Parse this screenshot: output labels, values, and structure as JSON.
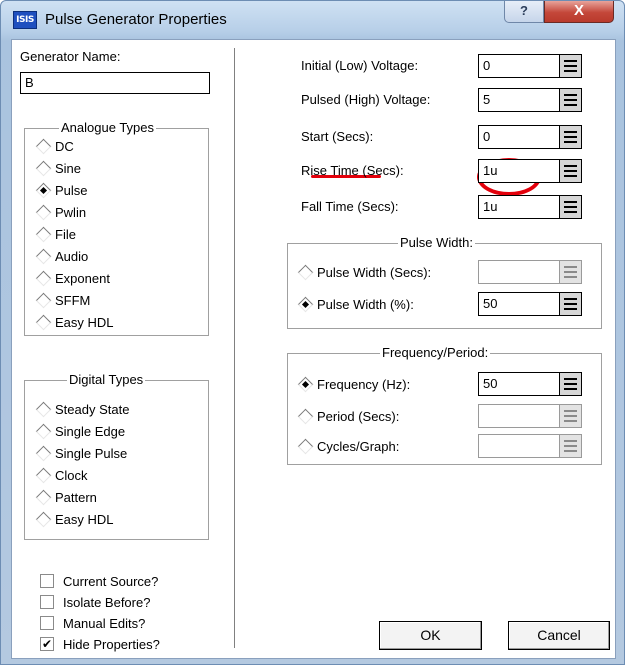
{
  "window": {
    "app_icon_text": "ISIS",
    "title": "Pulse Generator Properties",
    "help_glyph": "?",
    "close_glyph": "X"
  },
  "left": {
    "generator_name_label": "Generator Name:",
    "generator_name_value": "B",
    "analogue_title": "Analogue Types",
    "analogue": [
      {
        "label": "DC",
        "checked": false
      },
      {
        "label": "Sine",
        "checked": false
      },
      {
        "label": "Pulse",
        "checked": true
      },
      {
        "label": "Pwlin",
        "checked": false
      },
      {
        "label": "File",
        "checked": false
      },
      {
        "label": "Audio",
        "checked": false
      },
      {
        "label": "Exponent",
        "checked": false
      },
      {
        "label": "SFFM",
        "checked": false
      },
      {
        "label": "Easy HDL",
        "checked": false
      }
    ],
    "digital_title": "Digital Types",
    "digital": [
      {
        "label": "Steady State",
        "checked": false
      },
      {
        "label": "Single Edge",
        "checked": false
      },
      {
        "label": "Single Pulse",
        "checked": false
      },
      {
        "label": "Clock",
        "checked": false
      },
      {
        "label": "Pattern",
        "checked": false
      },
      {
        "label": "Easy HDL",
        "checked": false
      }
    ],
    "checkboxes": [
      {
        "label": "Current Source?",
        "checked": false
      },
      {
        "label": "Isolate Before?",
        "checked": false
      },
      {
        "label": "Manual Edits?",
        "checked": false
      },
      {
        "label": "Hide Properties?",
        "checked": true
      }
    ],
    "check_mark": "✔"
  },
  "right": {
    "fields": [
      {
        "label": "Initial (Low) Voltage:",
        "value": "0"
      },
      {
        "label": "Pulsed (High) Voltage:",
        "value": "5"
      },
      {
        "label": "Start (Secs):",
        "value": "0"
      },
      {
        "label": "Rise Time (Secs):",
        "value": "1u"
      },
      {
        "label": "Fall Time (Secs):",
        "value": "1u"
      }
    ],
    "pulse_width_title": "Pulse Width:",
    "pulse_width": [
      {
        "label": "Pulse Width (Secs):",
        "value": "",
        "checked": false,
        "enabled": false
      },
      {
        "label": "Pulse Width (%):",
        "value": "50",
        "checked": true,
        "enabled": true
      }
    ],
    "freq_title": "Frequency/Period:",
    "freq": [
      {
        "label": "Frequency (Hz):",
        "value": "50",
        "checked": true,
        "enabled": true
      },
      {
        "label": "Period (Secs):",
        "value": "",
        "checked": false,
        "enabled": false
      },
      {
        "label": "Cycles/Graph:",
        "value": "",
        "checked": false,
        "enabled": false
      }
    ],
    "ok_label": "OK",
    "cancel_label": "Cancel"
  },
  "colors": {
    "annotation": "#e3000b",
    "titlebar": "#b7cfe8",
    "close": "#c4473a"
  }
}
